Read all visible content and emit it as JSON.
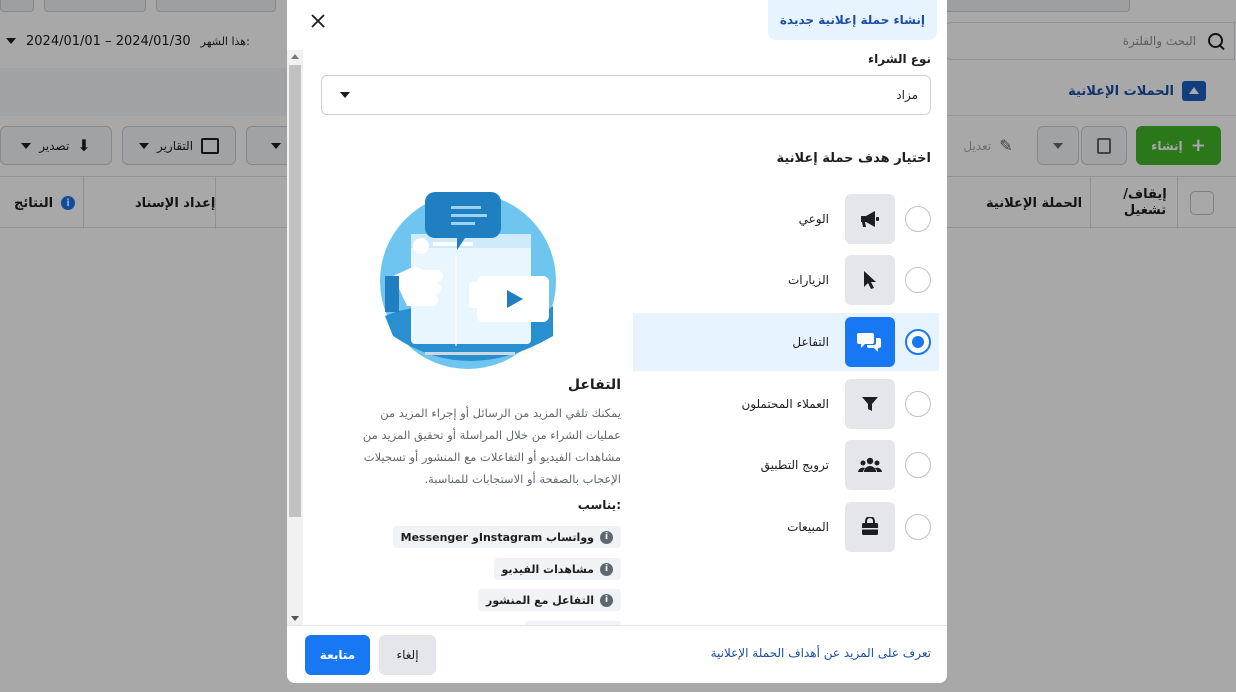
{
  "background": {
    "date_filter": {
      "label": "هذا الشهر:",
      "range": "2024/01/01 – 2024/01/30"
    },
    "search": {
      "placeholder": "البحث والفلترة"
    },
    "section": {
      "title": "الحملات الإعلانية"
    },
    "toolbar": {
      "create_label": "إنشاء",
      "edit_label": "تعديل",
      "reports_label": "التقارير",
      "export_label": "تصدير"
    },
    "table_headers": {
      "toggle": "إيقاف/ تشغيل",
      "campaign": "الحملة الإعلانية",
      "attribution": "إعداد الإسناد",
      "results": "النتائج"
    }
  },
  "modal": {
    "tab_title": "إنشاء حملة إعلانية جديدة",
    "buying_type": {
      "label": "نوع الشراء",
      "value": "مزاد"
    },
    "objective_heading": "اختيار هدف حملة إعلانية",
    "objectives": [
      {
        "label": "الوعي",
        "icon": "megaphone-icon",
        "selected": false
      },
      {
        "label": "الزيارات",
        "icon": "cursor-icon",
        "selected": false
      },
      {
        "label": "التفاعل",
        "icon": "chat-bubbles-icon",
        "selected": true
      },
      {
        "label": "العملاء المحتملون",
        "icon": "funnel-icon",
        "selected": false
      },
      {
        "label": "ترويج التطبيق",
        "icon": "people-icon",
        "selected": false
      },
      {
        "label": "المبيعات",
        "icon": "shopping-bag-icon",
        "selected": false
      }
    ],
    "detail": {
      "title": "التفاعل",
      "description": "يمكنك تلقي المزيد من الرسائل أو إجراء المزيد من عمليات الشراء من خلال المراسلة أو تحقيق المزيد من مشاهدات الفيديو أو التفاعلات مع المنشور أو تسجيلات الإعجاب بالصفحة أو الاستجابات للمناسبة.",
      "good_for_label": "يناسب:",
      "good_for": [
        "Messenger وInstagram وواتساب",
        "مشاهدات الفيديو",
        "التفاعل مع المنشور"
      ]
    },
    "footer": {
      "continue_label": "متابعة",
      "cancel_label": "إلغاء",
      "learn_more": "تعرف على المزيد عن أهداف الحملة الإعلانية"
    }
  },
  "colors": {
    "primary": "#1877f2",
    "selected_bg": "#e7f3ff",
    "create_green": "#42b72a"
  }
}
